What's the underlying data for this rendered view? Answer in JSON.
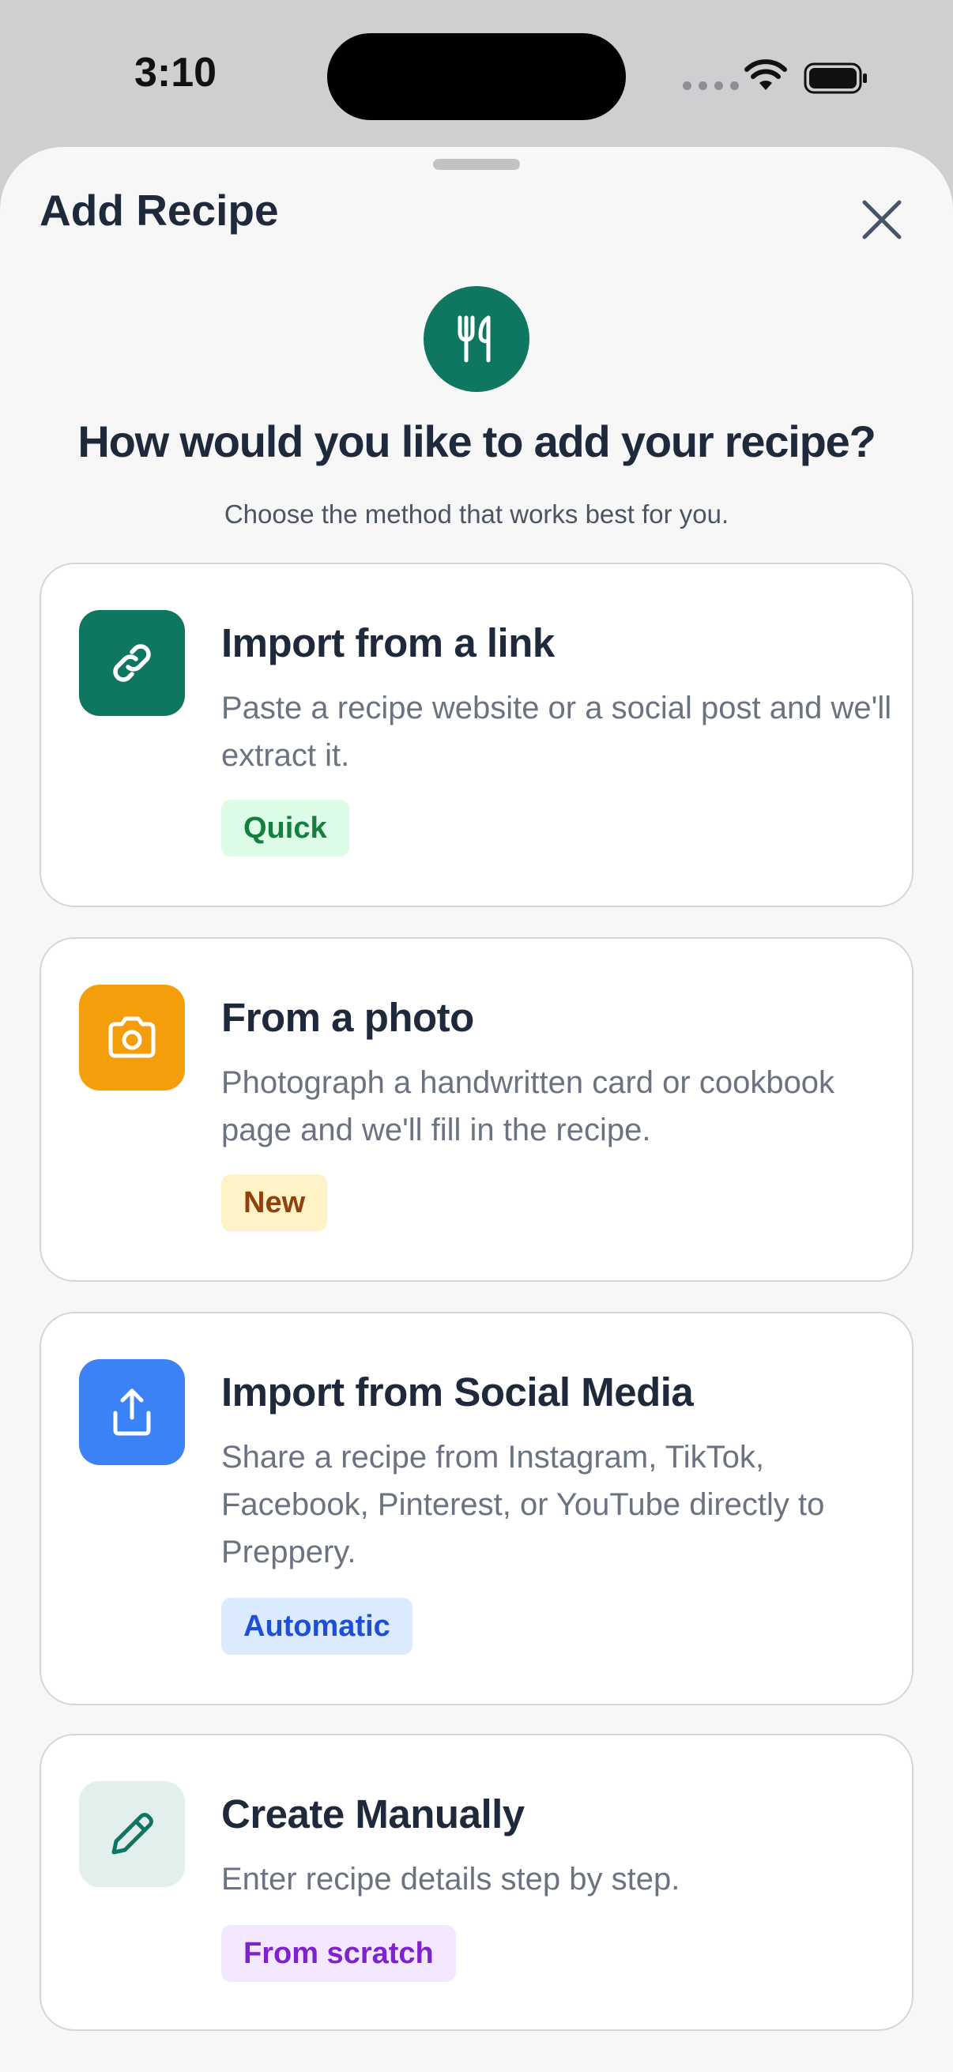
{
  "status_bar": {
    "time": "3:10"
  },
  "sheet": {
    "title": "Add Recipe",
    "close_icon": "close-icon"
  },
  "hero": {
    "icon": "utensils-icon",
    "icon_bg": "#0f7662",
    "question": "How would you like to add your recipe?",
    "subtitle": "Choose the method that works best for you."
  },
  "options": [
    {
      "title": "Import from a link",
      "description": "Paste a recipe website or a social post and we'll extract it.",
      "badge": "Quick",
      "icon": "link-icon",
      "icon_bg": "#0f7662",
      "badge_bg": "#dcfce7",
      "badge_color": "#15803d"
    },
    {
      "title": "From a photo",
      "description": "Photograph a handwritten card or cookbook page and we'll fill in the recipe.",
      "badge": "New",
      "icon": "camera-icon",
      "icon_bg": "#f59e0b",
      "badge_bg": "#fef3c7",
      "badge_color": "#92400e"
    },
    {
      "title": "Import from Social Media",
      "description": "Share a recipe from Instagram, TikTok, Facebook, Pinterest, or YouTube directly to Preppery.",
      "badge": "Automatic",
      "icon": "share-icon",
      "icon_bg": "#3b82f6",
      "badge_bg": "#dbeafe",
      "badge_color": "#1d4ed8"
    },
    {
      "title": "Create Manually",
      "description": "Enter recipe details step by step.",
      "badge": "From scratch",
      "icon": "pencil-icon",
      "icon_bg": "#e3efec",
      "badge_bg": "#f3e8ff",
      "badge_color": "#7e22ce"
    }
  ]
}
